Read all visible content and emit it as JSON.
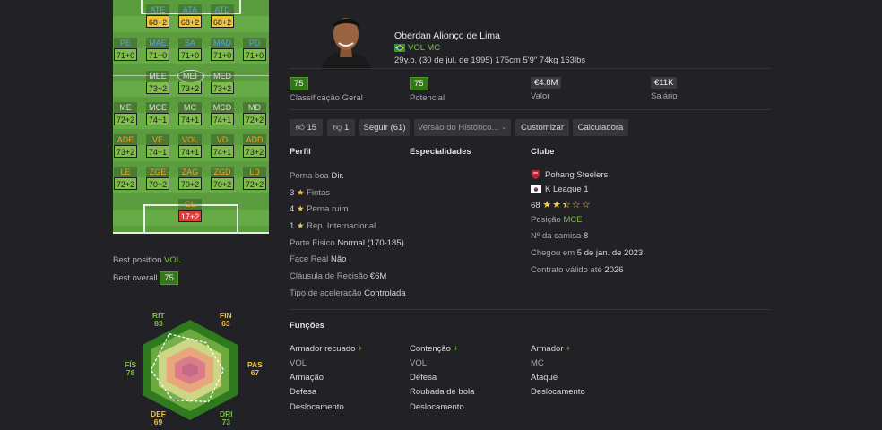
{
  "pitch": {
    "positions": [
      {
        "label": "ATE",
        "value": "68+2",
        "color": "#f0c23b"
      },
      {
        "label": "ATA",
        "value": "68+2",
        "color": "#f0c23b"
      },
      {
        "label": "ATD",
        "value": "68+2",
        "color": "#f0c23b"
      },
      {
        "label": "PE",
        "value": "71+0",
        "color": "#7fbe4a"
      },
      {
        "label": "MAE",
        "value": "71+0",
        "color": "#7fbe4a"
      },
      {
        "label": "SA",
        "value": "71+0",
        "color": "#7fbe4a"
      },
      {
        "label": "MAD",
        "value": "71+0",
        "color": "#7fbe4a"
      },
      {
        "label": "PD",
        "value": "71+0",
        "color": "#7fbe4a"
      },
      {
        "label": "MEE",
        "value": "73+2",
        "color": "#7fbe4a"
      },
      {
        "label": "MEI",
        "value": "73+2",
        "color": "#7fbe4a"
      },
      {
        "label": "MED",
        "value": "73+2",
        "color": "#7fbe4a"
      },
      {
        "label": "ME",
        "value": "72+2",
        "color": "#7fbe4a"
      },
      {
        "label": "MCE",
        "value": "74+1",
        "color": "#7fbe4a"
      },
      {
        "label": "MC",
        "value": "74+1",
        "color": "#7fbe4a"
      },
      {
        "label": "MCD",
        "value": "74+1",
        "color": "#7fbe4a"
      },
      {
        "label": "MD",
        "value": "72+2",
        "color": "#7fbe4a"
      },
      {
        "label": "ADE",
        "value": "73+2",
        "color": "#7fbe4a"
      },
      {
        "label": "VE",
        "value": "74+1",
        "color": "#7fbe4a"
      },
      {
        "label": "VOL",
        "value": "74+1",
        "color": "#7fbe4a"
      },
      {
        "label": "VD",
        "value": "74+1",
        "color": "#7fbe4a"
      },
      {
        "label": "ADD",
        "value": "73+2",
        "color": "#7fbe4a"
      },
      {
        "label": "LE",
        "value": "72+2",
        "color": "#7fbe4a"
      },
      {
        "label": "ZGE",
        "value": "70+2",
        "color": "#7fbe4a"
      },
      {
        "label": "ZAG",
        "value": "70+2",
        "color": "#7fbe4a"
      },
      {
        "label": "ZGD",
        "value": "70+2",
        "color": "#7fbe4a"
      },
      {
        "label": "LD",
        "value": "72+2",
        "color": "#7fbe4a"
      },
      {
        "label": "GL",
        "value": "17+2",
        "color": "#e03a3a"
      }
    ]
  },
  "best": {
    "position_label": "Best position",
    "position": "VOL",
    "overall_label": "Best overall",
    "overall": "75"
  },
  "radar": {
    "axes": [
      {
        "label": "RIT",
        "value": "83"
      },
      {
        "label": "FIN",
        "value": "63"
      },
      {
        "label": "PAS",
        "value": "67"
      },
      {
        "label": "DRI",
        "value": "73"
      },
      {
        "label": "DEF",
        "value": "69"
      },
      {
        "label": "FÍS",
        "value": "78"
      }
    ]
  },
  "player": {
    "name": "Oberdan Alionço de Lima",
    "positions": "VOL MC",
    "info": "29y.o. (30 de jul. de 1995) 175cm 5'9\" 74kg 163lbs"
  },
  "stats": [
    {
      "value": "75",
      "label": "Classificação Geral"
    },
    {
      "value": "75",
      "label": "Potencial"
    },
    {
      "value": "€4.8M",
      "label": "Valor"
    },
    {
      "value": "€11K",
      "label": "Salário"
    }
  ],
  "actions": {
    "likes": "15",
    "dislikes": "1",
    "follow": "Seguir (61)",
    "history": "Versão do Histórico...",
    "customize": "Customizar",
    "calculator": "Calculadora"
  },
  "perfil": {
    "title": "Perfil",
    "foot_label": "Perna boa",
    "foot": "Dir.",
    "skill_moves_n": "3",
    "skill_moves": "Fintas",
    "weak_foot_n": "4",
    "weak_foot": "Perna ruim",
    "rep_n": "1",
    "rep": "Rep. Internacional",
    "body_label": "Porte Físico",
    "body": "Normal (170-185)",
    "real_face_label": "Face Real",
    "real_face": "Não",
    "release_label": "Cláusula de Recisão",
    "release": "€6M",
    "accel_label": "Tipo de aceleração",
    "accel": "Controlada"
  },
  "especialidades": {
    "title": "Especialidades"
  },
  "clube": {
    "title": "Clube",
    "name": "Pohang Steelers",
    "league": "K League 1",
    "rating": "68",
    "pos_label": "Posição",
    "pos": "MCE",
    "kit_label": "Nº da camisa",
    "kit": "8",
    "joined_label": "Chegou em",
    "joined": "5 de jan. de 2023",
    "contract_label": "Contrato válido até",
    "contract": "2026"
  },
  "funcoes": {
    "title": "Funções",
    "cols": [
      {
        "role": "Armador recuado",
        "pos": "VOL",
        "items": [
          "Armação",
          "Defesa",
          "Deslocamento"
        ]
      },
      {
        "role": "Contenção",
        "pos": "VOL",
        "items": [
          "Defesa",
          "Roubada de bola",
          "Deslocamento"
        ]
      },
      {
        "role": "Armador",
        "pos": "MC",
        "items": [
          "Ataque",
          "Deslocamento"
        ]
      }
    ]
  },
  "colors": {
    "accent": "#7cc043",
    "badge_green": "#35761c",
    "badge_gray": "#3a3a40",
    "gold": "#f0c23b",
    "red": "#e03a3a"
  }
}
